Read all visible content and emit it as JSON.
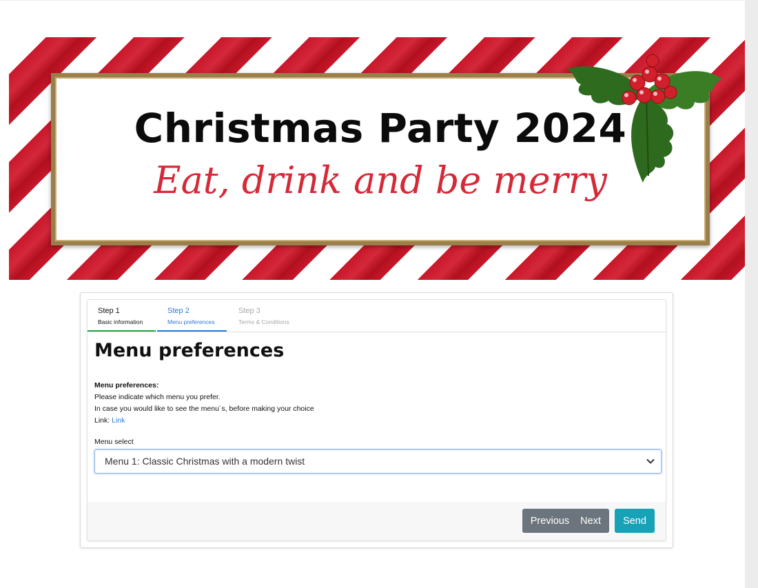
{
  "banner": {
    "title": "Christmas Party 2024",
    "tagline": "Eat, drink and be merry",
    "colors": {
      "stripe": "#c8172a",
      "frame": "#9b7f4a",
      "tagline": "#d42a38"
    }
  },
  "steps": [
    {
      "number": "Step 1",
      "label": "Basic information",
      "state": "done"
    },
    {
      "number": "Step 2",
      "label": "Menu preferences",
      "state": "active"
    },
    {
      "number": "Step 3",
      "label": "Terms & Conditions",
      "state": "todo"
    }
  ],
  "form": {
    "heading": "Menu preferences",
    "info_title": "Menu preferences:",
    "info_line1": "Please indicate which menu you prefer.",
    "info_line2": "In case you would like to see the menu´s, before making your choice",
    "link_prefix": "Link:",
    "link_text": "Link",
    "select_label": "Menu select",
    "select_value": "Menu 1: Classic Christmas with a modern twist"
  },
  "buttons": {
    "previous": "Previous",
    "next": "Next",
    "send": "Send"
  },
  "colors": {
    "step_done": "#28a745",
    "step_active": "#2a7ad9",
    "btn_secondary": "#6c757d",
    "btn_send": "#17a2b8"
  }
}
